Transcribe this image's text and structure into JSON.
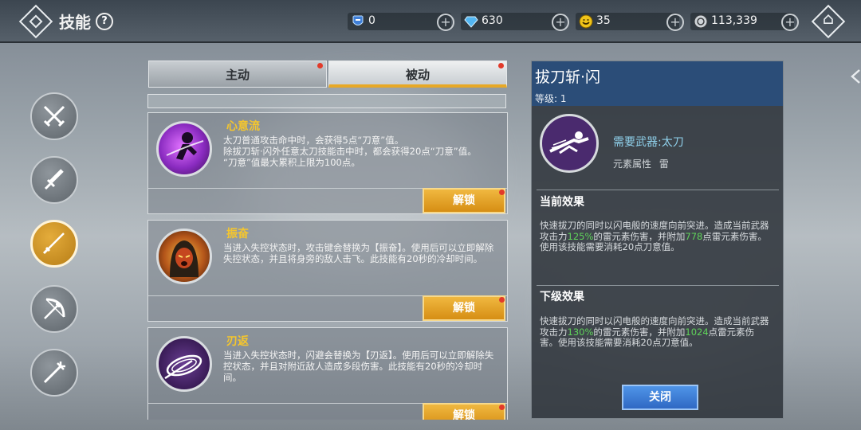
{
  "header": {
    "title": "技能",
    "help_glyph": "?"
  },
  "resources": [
    {
      "name": "shield-ticket",
      "value": "0",
      "color": "#3f7fd8"
    },
    {
      "name": "diamond",
      "value": "630",
      "color": "#53b6f2"
    },
    {
      "name": "smile-coin",
      "value": "35",
      "color": "#f0c419"
    },
    {
      "name": "coin",
      "value": "113,339",
      "color": "#cfd4d8"
    }
  ],
  "side_nav": [
    {
      "name": "dual-swords",
      "active": false
    },
    {
      "name": "sword",
      "active": false
    },
    {
      "name": "katana",
      "active": true
    },
    {
      "name": "bow",
      "active": false
    },
    {
      "name": "trident",
      "active": false
    }
  ],
  "tabs": [
    {
      "label": "主动",
      "active": false
    },
    {
      "label": "被动",
      "active": true
    }
  ],
  "skills": [
    {
      "name": "心意流",
      "desc": "太刀普通攻击命中时，会获得5点“刀意”值。\n除拔刀斩·闪外任意太刀技能击中时，都会获得20点“刀意”值。\n“刀意”值最大累积上限为100点。",
      "button": "解锁"
    },
    {
      "name": "振奋",
      "desc": "当进入失控状态时，攻击键会替换为【振奋】。使用后可以立即解除失控状态，并且将身旁的敌人击飞。此技能有20秒的冷却时间。",
      "button": "解锁"
    },
    {
      "name": "刃返",
      "desc": "当进入失控状态时，闪避会替换为【刃返】。使用后可以立即解除失控状态，并且对附近敌人造成多段伤害。此技能有20秒的冷却时间。",
      "button": "解锁"
    }
  ],
  "detail": {
    "name": "拔刀斩·闪",
    "level": "等级: 1",
    "requirement": "需要武器:太刀",
    "element_label": "元素属性",
    "element_value": "雷",
    "current_title": "当前效果",
    "current_text_a": "快速拔刀的同时以闪电般的速度向前突进。造成当前武器攻击力",
    "current_pct": "125%",
    "current_text_b": "的雷元素伤害，并附加",
    "current_add": "778",
    "current_text_c": "点雷元素伤害。使用该技能需要消耗20点刀意值。",
    "next_title": "下级效果",
    "next_text_a": "快速拔刀的同时以闪电般的速度向前突进。造成当前武器攻击力",
    "next_pct": "130%",
    "next_text_b": "的雷元素伤害，并附加",
    "next_add": "1024",
    "next_text_c": "点雷元素伤害。使用该技能需要消耗20点刀意值。",
    "close_label": "关闭"
  }
}
